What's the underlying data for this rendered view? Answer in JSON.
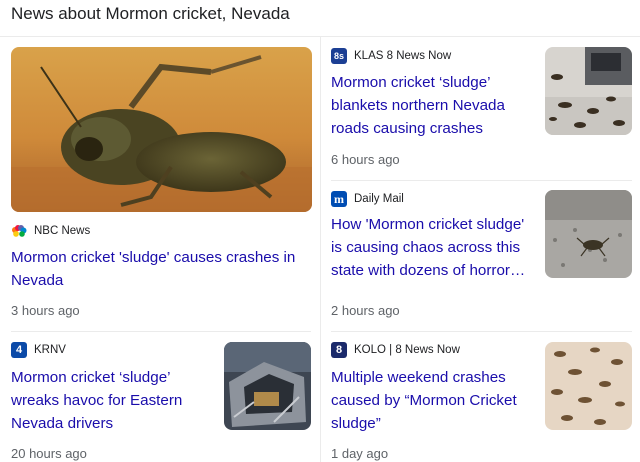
{
  "heading": "News about Mormon cricket, Nevada",
  "articles": [
    {
      "source": "NBC News",
      "title": "Mormon cricket 'sludge' causes crashes in Nevada",
      "time": "3 hours ago",
      "logo": "nbc-peacock-icon"
    },
    {
      "source": "KLAS 8 News Now",
      "title": "Mormon cricket ‘sludge’ blankets northern Nevada roads causing crashes",
      "time": "6 hours ago",
      "logo": "klas-8s-icon",
      "logo_text": "8s"
    },
    {
      "source": "Daily Mail",
      "title": "How 'Mormon cricket sludge' is causing chaos across this state with dozens of horror…",
      "time": "2 hours ago",
      "logo": "daily-mail-icon",
      "logo_text": "m"
    },
    {
      "source": "KRNV",
      "title": "Mormon cricket ‘sludge’ wreaks havoc for Eastern Nevada drivers",
      "time": "20 hours ago",
      "logo": "krnv-4-icon",
      "logo_text": "4"
    },
    {
      "source": "KOLO | 8 News Now",
      "title": "Multiple weekend crashes caused by “Mormon Cricket sludge”",
      "time": "1 day ago",
      "logo": "kolo-8-icon",
      "logo_text": "8"
    }
  ],
  "colors": {
    "link": "#1a0dab",
    "meta": "#5f6368",
    "divider": "#ebebeb"
  }
}
